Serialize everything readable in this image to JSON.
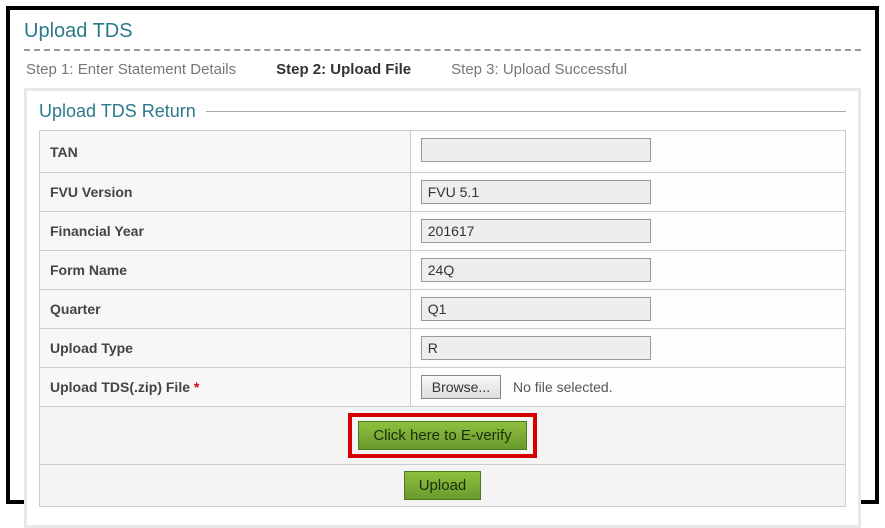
{
  "page": {
    "title": "Upload TDS"
  },
  "steps": {
    "s1": "Step 1: Enter Statement Details",
    "s2": "Step 2: Upload File",
    "s3": "Step 3: Upload Successful"
  },
  "section": {
    "title": "Upload TDS Return"
  },
  "labels": {
    "tan": "TAN",
    "fvu": "FVU Version",
    "fy": "Financial Year",
    "form": "Form Name",
    "quarter": "Quarter",
    "uptype": "Upload Type",
    "file": "Upload TDS(.zip) File ",
    "req": "*"
  },
  "values": {
    "tan": "",
    "fvu": "FVU 5.1",
    "fy": "201617",
    "form": "24Q",
    "quarter": "Q1",
    "uptype": "R"
  },
  "file": {
    "browse": "Browse...",
    "status": "No file selected."
  },
  "buttons": {
    "everify": "Click here to E-verify",
    "upload": "Upload"
  }
}
